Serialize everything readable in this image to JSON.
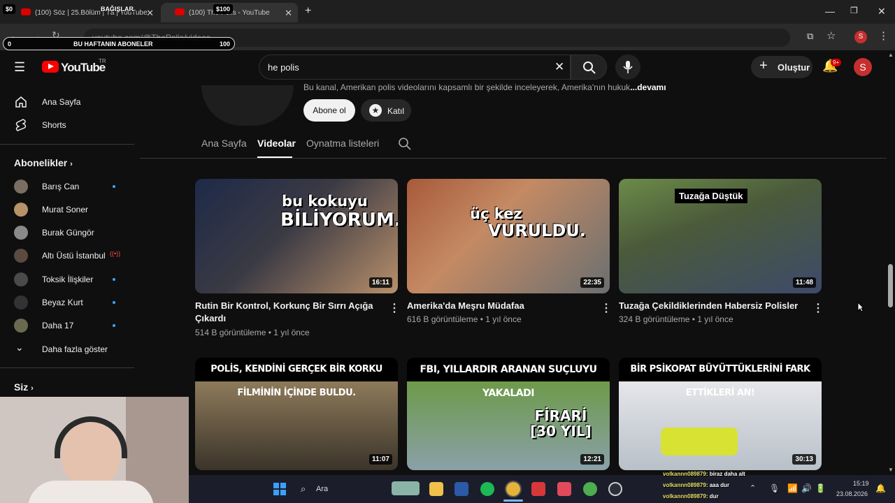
{
  "browser": {
    "tabs": [
      {
        "title": "(100) Söz | 25.Bölüm | Tȧ | YouTube",
        "active": false
      },
      {
        "title": "(100) The Polis - YouTube",
        "active": true
      }
    ],
    "url": "youtube.com/@ThePolis/videos",
    "new_tab": "+"
  },
  "overlays": {
    "left_amount": "$0",
    "donations_label": "BAĞIŞLAR",
    "donation_amount": "$100",
    "subgoal_start": "0",
    "subgoal_label": "BU HAFTANIN ABONELER",
    "subgoal_end": "100"
  },
  "header": {
    "logo_text": "YouTube",
    "region": "TR",
    "search_value": "he polis",
    "create_label": "Oluştur",
    "notif_count": "9+",
    "avatar_letter": "S"
  },
  "sidebar": {
    "main": [
      {
        "label": "Ana Sayfa",
        "icon": "home-icon"
      },
      {
        "label": "Shorts",
        "icon": "shorts-icon"
      }
    ],
    "subs_title": "Abonelikler",
    "subscriptions": [
      {
        "label": "Barış Can",
        "status": "new"
      },
      {
        "label": "Murat Soner",
        "status": ""
      },
      {
        "label": "Burak Güngör",
        "status": ""
      },
      {
        "label": "Altı Üstü İstanbul",
        "status": "live"
      },
      {
        "label": "Toksik İlişkiler",
        "status": "new"
      },
      {
        "label": "Beyaz Kurt",
        "status": "new"
      },
      {
        "label": "Daha 17",
        "status": "new"
      }
    ],
    "more_label": "Daha fazla göster",
    "you_title": "Siz"
  },
  "channel": {
    "description": "Bu kanal, Amerikan polis videolarını kapsamlı bir şekilde inceleyerek, Amerika'nın hukuk",
    "more": "...devamı",
    "subscribe_label": "Abone ol",
    "join_label": "Katıl",
    "tabs": [
      {
        "label": "Ana Sayfa",
        "active": false
      },
      {
        "label": "Videolar",
        "active": true
      },
      {
        "label": "Oynatma listeleri",
        "active": false
      }
    ]
  },
  "videos": [
    {
      "title": "Rutin Bir Kontrol, Korkunç Bir Sırrı Açığa Çıkardı",
      "views": "514 B görüntüleme",
      "age": "1 yıl önce",
      "duration": "16:11",
      "thumb_text_1": "bu kokuyu",
      "thumb_text_2": "BİLİYORUM."
    },
    {
      "title": "Amerika'da Meşru Müdafaa",
      "views": "616 B görüntüleme",
      "age": "1 yıl önce",
      "duration": "22:35",
      "thumb_text_1": "üç kez",
      "thumb_text_2": "VURULDU."
    },
    {
      "title": "Tuzağa Çekildiklerinden Habersiz Polisler",
      "views": "324 B görüntüleme",
      "age": "1 yıl önce",
      "duration": "11:48",
      "thumb_text_1": "Tuzağa Düştük",
      "thumb_text_2": ""
    },
    {
      "title": "",
      "views": "",
      "age": "",
      "duration": "11:07",
      "thumb_text_1": "POLİS, KENDİNİ GERÇEK BİR KORKU FİLMİNİN İÇİNDE BULDU.",
      "thumb_text_2": ""
    },
    {
      "title": "",
      "views": "",
      "age": "",
      "duration": "12:21",
      "thumb_text_1": "FBI, YILLARDIR ARANAN SUÇLUYU YAKALADI",
      "thumb_text_2": "FİRARİ\n[30 YIL]"
    },
    {
      "title": "",
      "views": "",
      "age": "",
      "duration": "30:13",
      "thumb_text_1": "BİR PSİKOPAT BÜYÜTTÜKLERİNİ FARK ETTİKLERİ AN!",
      "thumb_text_2": ""
    }
  ],
  "taskbar": {
    "search_label": "Ara",
    "time": "15:19",
    "date": "23.08.2026"
  },
  "chat": [
    {
      "user": "volkannn089879",
      "msg": ": biraz daha alt"
    },
    {
      "user": "volkannn089879",
      "msg": ": aaa dur"
    },
    {
      "user": "volkannn089879",
      "msg": ": dur"
    }
  ],
  "colors": {
    "accent": "#ff0000",
    "live": "#ff4e45",
    "new_dot": "#3ea6ff"
  }
}
